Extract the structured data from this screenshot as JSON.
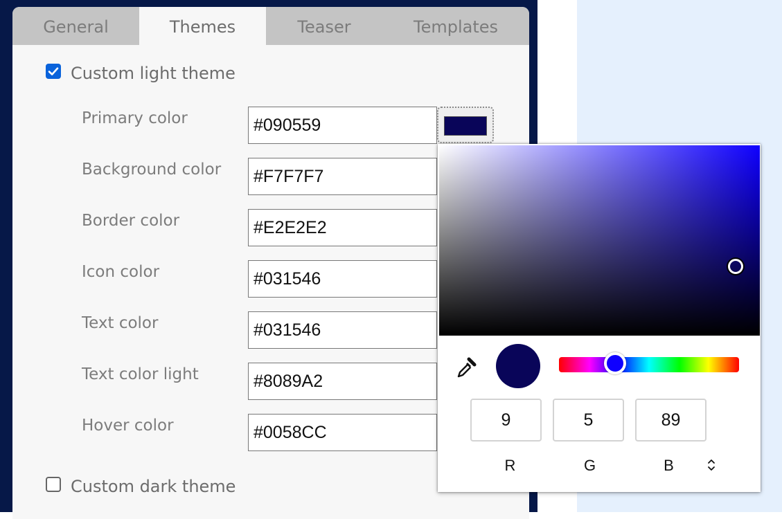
{
  "tabs": [
    "General",
    "Themes",
    "Teaser",
    "Templates"
  ],
  "active_tab": "Themes",
  "light_theme": {
    "label": "Custom light theme",
    "checked": true
  },
  "dark_theme": {
    "label": "Custom dark theme",
    "checked": false
  },
  "fields": [
    {
      "label": "Primary color",
      "value": "#090559"
    },
    {
      "label": "Background color",
      "value": "#F7F7F7"
    },
    {
      "label": "Border color",
      "value": "#E2E2E2"
    },
    {
      "label": "Icon color",
      "value": "#031546"
    },
    {
      "label": "Text color",
      "value": "#031546"
    },
    {
      "label": "Text color light",
      "value": "#8089A2"
    },
    {
      "label": "Hover color",
      "value": "#0058CC"
    }
  ],
  "picker": {
    "r": "9",
    "g": "5",
    "b": "89",
    "r_label": "R",
    "g_label": "G",
    "b_label": "B",
    "current_color": "#090559",
    "hue_color": "#0F00FF",
    "icons": [
      "eyedropper-icon",
      "mode-toggle-icon"
    ]
  },
  "colors": {
    "accent": "#0A63DB",
    "page_background": "#061848",
    "side_background": "#E5F0FD"
  }
}
